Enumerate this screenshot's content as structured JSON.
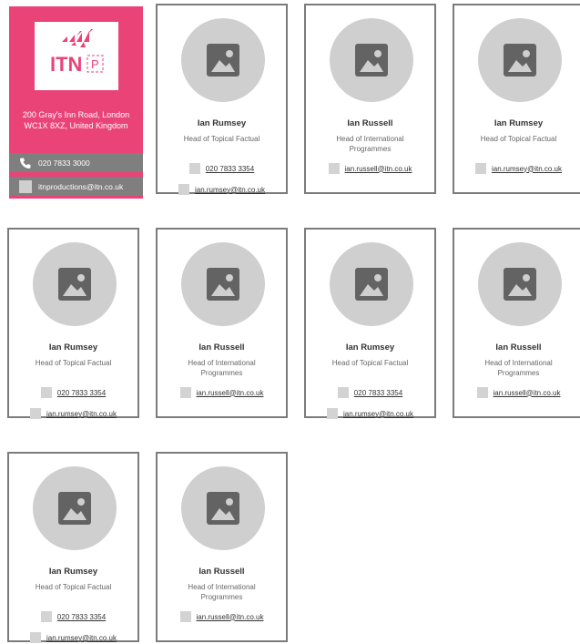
{
  "company": {
    "logo_text": "ITN",
    "logo_badge": "P",
    "address_line1": "200 Gray's Inn Road, London",
    "address_line2": "WC1X 8XZ, United Kingdom",
    "phone": "020 7833 3000",
    "email": "itnproductions@itn.co.uk",
    "brand_color": "#ea4378"
  },
  "cards": [
    {
      "name": "Ian Rumsey",
      "role": "Head of Topical Factual",
      "phone": "020 7833 3354",
      "email": "ian.rumsey@itn.co.uk"
    },
    {
      "name": "Ian Russell",
      "role": "Head of International Programmes",
      "phone": "",
      "email": "ian.russell@itn.co.uk"
    },
    {
      "name": "Ian Rumsey",
      "role": "Head of Topical Factual",
      "phone": "",
      "email": "ian.rumsey@itn.co.uk"
    },
    {
      "name": "Ian Rumsey",
      "role": "Head of Topical Factual",
      "phone": "020 7833 3354",
      "email": "ian.rumsey@itn.co.uk"
    },
    {
      "name": "Ian Russell",
      "role": "Head of International Programmes",
      "phone": "",
      "email": "ian.russell@itn.co.uk"
    },
    {
      "name": "Ian Rumsey",
      "role": "Head of Topical Factual",
      "phone": "020 7833 3354",
      "email": "ian.rumsey@itn.co.uk"
    },
    {
      "name": "Ian Russell",
      "role": "Head of International Programmes",
      "phone": "",
      "email": "ian.russell@itn.co.uk"
    },
    {
      "name": "Ian Rumsey",
      "role": "Head of Topical Factual",
      "phone": "020 7833 3354",
      "email": "ian.rumsey@itn.co.uk"
    },
    {
      "name": "Ian Russell",
      "role": "Head of International Programmes",
      "phone": "",
      "email": "ian.russell@itn.co.uk"
    }
  ]
}
